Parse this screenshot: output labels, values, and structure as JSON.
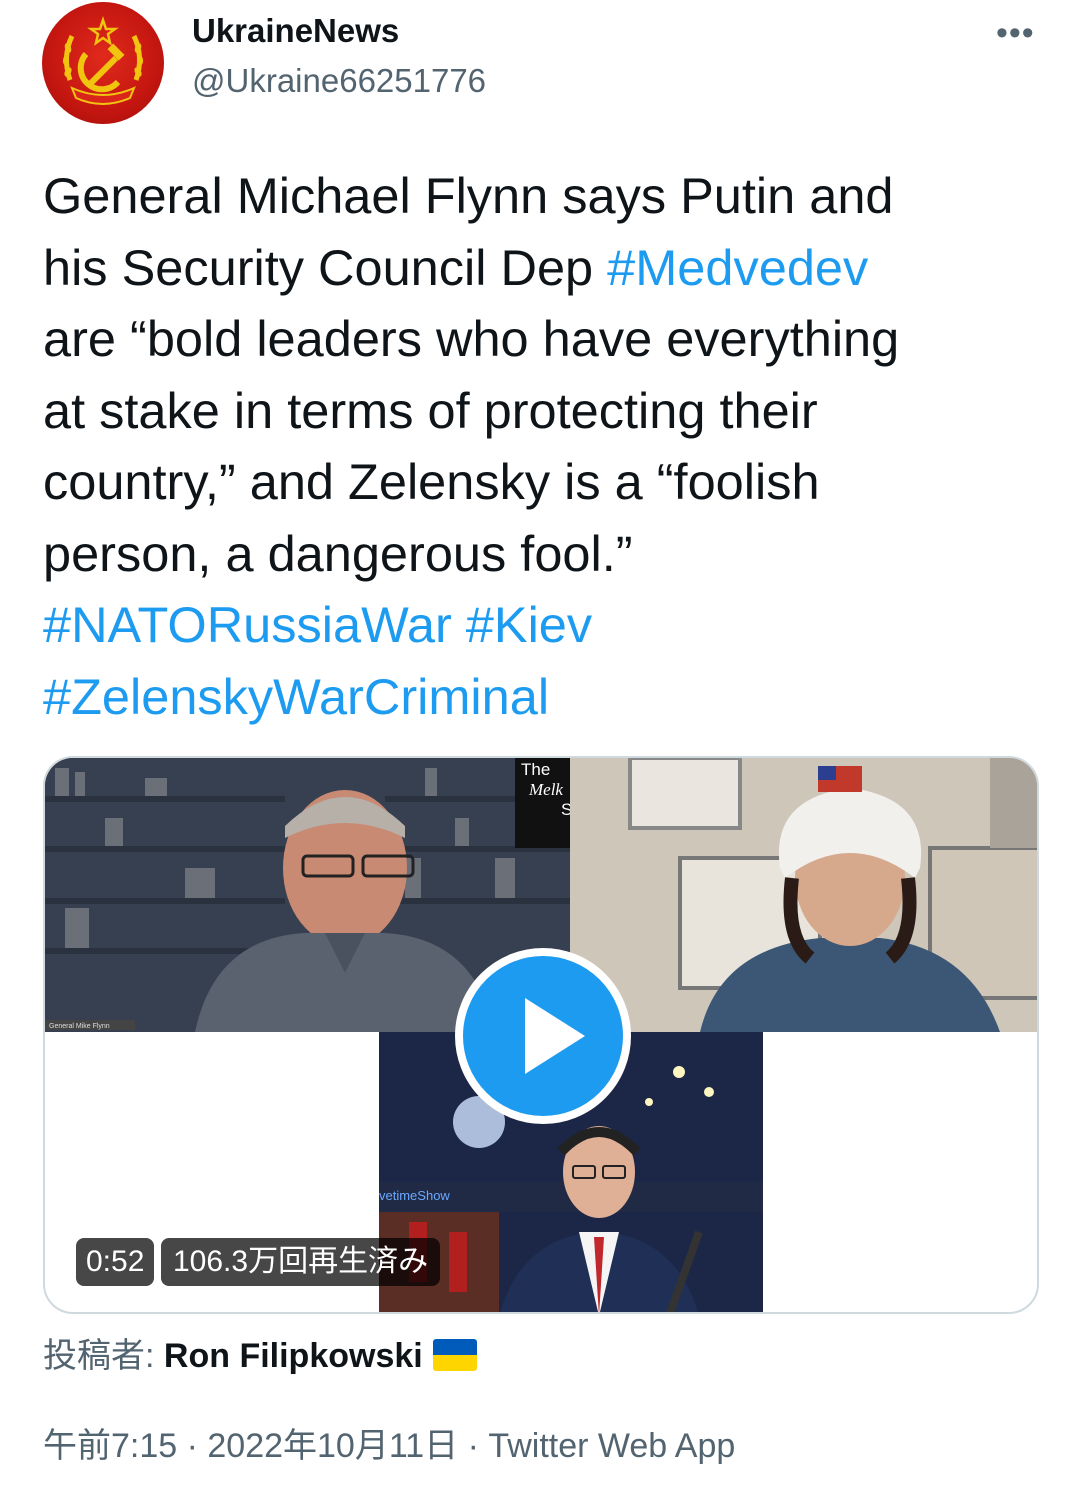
{
  "account": {
    "display_name": "UkraineNews",
    "handle": "@Ukraine66251776",
    "more_label": "•••"
  },
  "tweet": {
    "lines": [
      [
        {
          "text": "General Michael Flynn says Putin and",
          "hashtag": false
        }
      ],
      [
        {
          "text": "his Security Council Dep ",
          "hashtag": false
        },
        {
          "text": "#Medvedev",
          "hashtag": true
        }
      ],
      [
        {
          "text": "are “bold leaders who have everything",
          "hashtag": false
        }
      ],
      [
        {
          "text": "at stake in terms of protecting their",
          "hashtag": false
        }
      ],
      [
        {
          "text": "country,” and Zelensky is a “foolish",
          "hashtag": false
        }
      ],
      [
        {
          "text": "person, a dangerous fool.”",
          "hashtag": false
        }
      ],
      [
        {
          "text": "#NATORussiaWar",
          "hashtag": true
        },
        {
          "text": " ",
          "hashtag": false
        },
        {
          "text": "#Kiev",
          "hashtag": true
        }
      ],
      [
        {
          "text": "#ZelenskyWarCriminal",
          "hashtag": true
        }
      ]
    ]
  },
  "media": {
    "duration": "0:52",
    "views": "106.3万回再生済み",
    "overlay_show_title": [
      "The",
      "Melk",
      "Show"
    ],
    "lower_third": "General Mike Flynn",
    "watermark": "vetimeShow"
  },
  "attribution": {
    "prefix": "投稿者: ",
    "poster": "Ron Filipkowski",
    "flag_colors": [
      "#005bbb",
      "#ffd500"
    ]
  },
  "meta": {
    "text": "午前7:15 · 2022年10月11日 · Twitter Web App"
  },
  "colors": {
    "link": "#1d9bf0",
    "secondary": "#536471",
    "primary": "#0f1419"
  }
}
